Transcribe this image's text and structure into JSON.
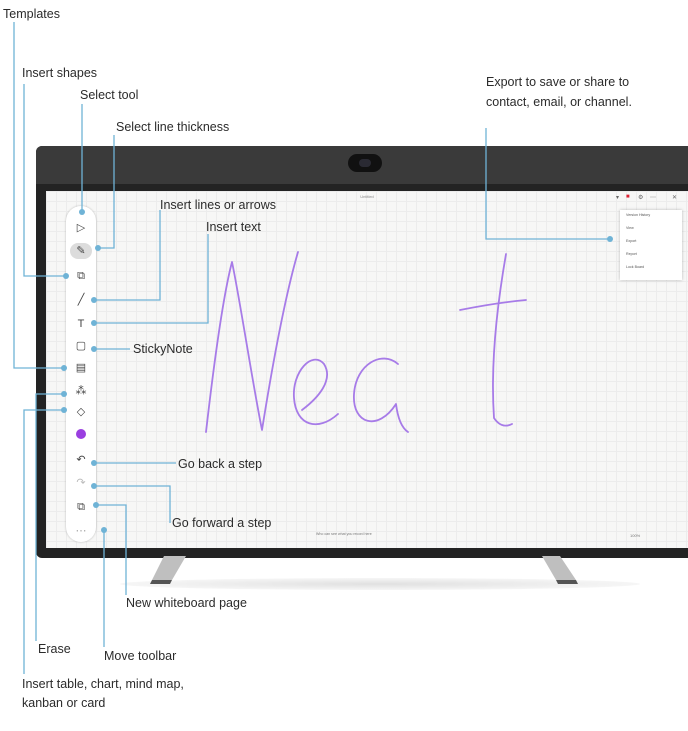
{
  "labels": {
    "templates": "Templates",
    "insert_shapes": "Insert shapes",
    "select_tool": "Select tool",
    "select_line_thickness": "Select line thickness",
    "export": "Export to save or share to contact, email, or channel.",
    "insert_lines_or_arrows": "Insert lines or arrows",
    "insert_text": "Insert text",
    "sticky_note": "StickyNote",
    "go_back_a_step": "Go back a step",
    "go_forward_a_step": "Go forward a step",
    "new_whiteboard_page": "New whiteboard page",
    "erase": "Erase",
    "move_toolbar": "Move toolbar",
    "insert_table": "Insert table, chart, mind map, kanban or card"
  },
  "screen": {
    "title": "Untitled",
    "menu_items": [
      "Version History",
      "View",
      "Export",
      "Report",
      "Lock Board"
    ],
    "bottom_hint": "Who can see what you record here",
    "zoom": "100%"
  },
  "whiteboard": {
    "handwriting": "Neat",
    "ink_color": "#a77be8"
  },
  "toolbar": {
    "tools": [
      {
        "name": "select",
        "glyph": "▷"
      },
      {
        "name": "pen",
        "glyph": "✎"
      },
      {
        "name": "shapes",
        "glyph": "⧉"
      },
      {
        "name": "line",
        "glyph": "╱"
      },
      {
        "name": "text",
        "glyph": "T"
      },
      {
        "name": "sticky-note",
        "glyph": "▢"
      },
      {
        "name": "templates",
        "glyph": "▤"
      },
      {
        "name": "insert-table",
        "glyph": "⁂"
      },
      {
        "name": "eraser",
        "glyph": "◇"
      },
      {
        "name": "color",
        "glyph": ""
      },
      {
        "name": "undo",
        "glyph": "↶"
      },
      {
        "name": "redo",
        "glyph": "↷"
      },
      {
        "name": "new-page",
        "glyph": "⧉"
      },
      {
        "name": "move-toolbar",
        "glyph": "⋯"
      }
    ],
    "accent_color": "#9a3fe0"
  },
  "callout_color": "#6fb3d6"
}
